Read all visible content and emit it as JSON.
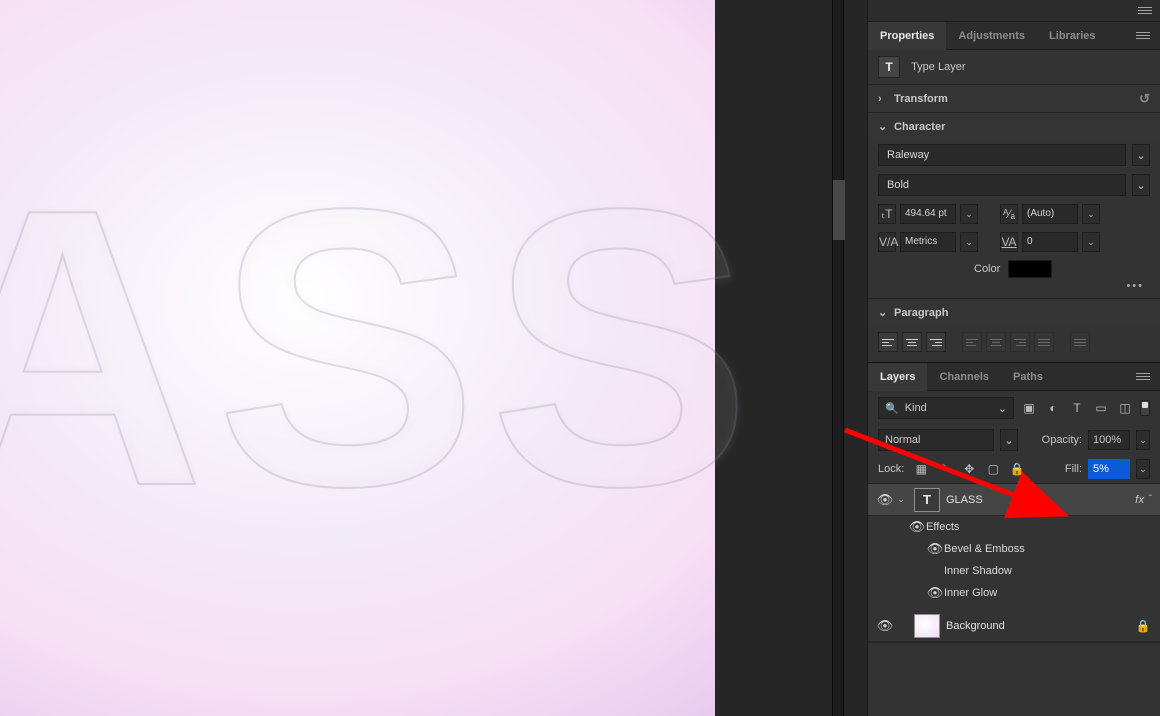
{
  "canvas": {
    "text": "ASS"
  },
  "properties": {
    "tabs": {
      "properties": "Properties",
      "adjustments": "Adjustments",
      "libraries": "Libraries"
    },
    "type_label": "Type Layer",
    "transform_label": "Transform",
    "character_label": "Character",
    "font_family": "Raleway",
    "font_style": "Bold",
    "font_size": "494.64 pt",
    "leading": "(Auto)",
    "kerning": "Metrics",
    "tracking": "0",
    "color_label": "Color",
    "paragraph_label": "Paragraph"
  },
  "layers": {
    "tabs": {
      "layers": "Layers",
      "channels": "Channels",
      "paths": "Paths"
    },
    "filter_kind": "Kind",
    "blend_mode": "Normal",
    "opacity_label": "Opacity:",
    "opacity_value": "100%",
    "lock_label": "Lock:",
    "fill_label": "Fill:",
    "fill_value": "5%",
    "layer_glass": "GLASS",
    "fx_label": "fx",
    "effects_label": "Effects",
    "eff_bevel": "Bevel & Emboss",
    "eff_inner_shadow": "Inner Shadow",
    "eff_inner_glow": "Inner Glow",
    "layer_bg": "Background"
  }
}
